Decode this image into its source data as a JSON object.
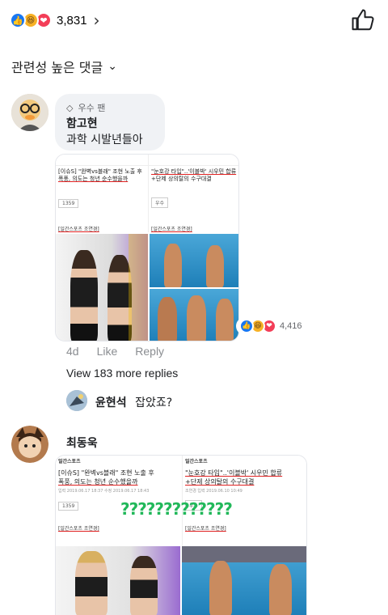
{
  "top": {
    "reaction_count": "3,831",
    "reactions": [
      "like-icon",
      "haha-icon",
      "love-icon"
    ]
  },
  "sort": {
    "label": "관련성 높은 댓글"
  },
  "comment1": {
    "badge": "우수 팬",
    "author": "함고현",
    "text": "과학 시발년들아",
    "time": "4d",
    "like": "Like",
    "reply": "Reply",
    "reaction_count": "4,416",
    "view_more": "View 183 more replies",
    "news_left": {
      "header": "[이슈S] \"완벽vs블래\" 조현 노출 후",
      "title_line2": "폭풍, 의도는 청년 순수했을까",
      "views": "1359",
      "author": "[일간스포츠 조연경]"
    },
    "news_right": {
      "header": "\"눈호강 타입\"..'이블박' 시우민 합류",
      "title_line2": "+단제 상의탈의 수구대결",
      "views": "우수",
      "author": "[일간스포츠 조연경]"
    }
  },
  "reply1": {
    "author": "윤현석",
    "text": "잡았죠?"
  },
  "comment2": {
    "author": "최동욱",
    "qmarks": "?????????????",
    "news_left": {
      "source": "일간스포츠",
      "title_line1": "[이슈S] \"완벽vs블래\" 조현 노출 후",
      "title_line2": "폭풍, 의도는 청년 순수했을까",
      "date": "입력 2019.06.17 18:37  수정 2019.06.17 18:43",
      "views": "1359",
      "author": "[일간스포츠 조연경]"
    },
    "news_right": {
      "source": "일간스포츠",
      "title_line1": "\"눈호강 타입\"..'이블박' 시우민 합류",
      "title_line2": "+단제 상의탈의 수구대결",
      "date": "조연경  입력 2019.06.10 10:49",
      "views": "우수",
      "author": "[일간스포츠 조연경]"
    }
  }
}
